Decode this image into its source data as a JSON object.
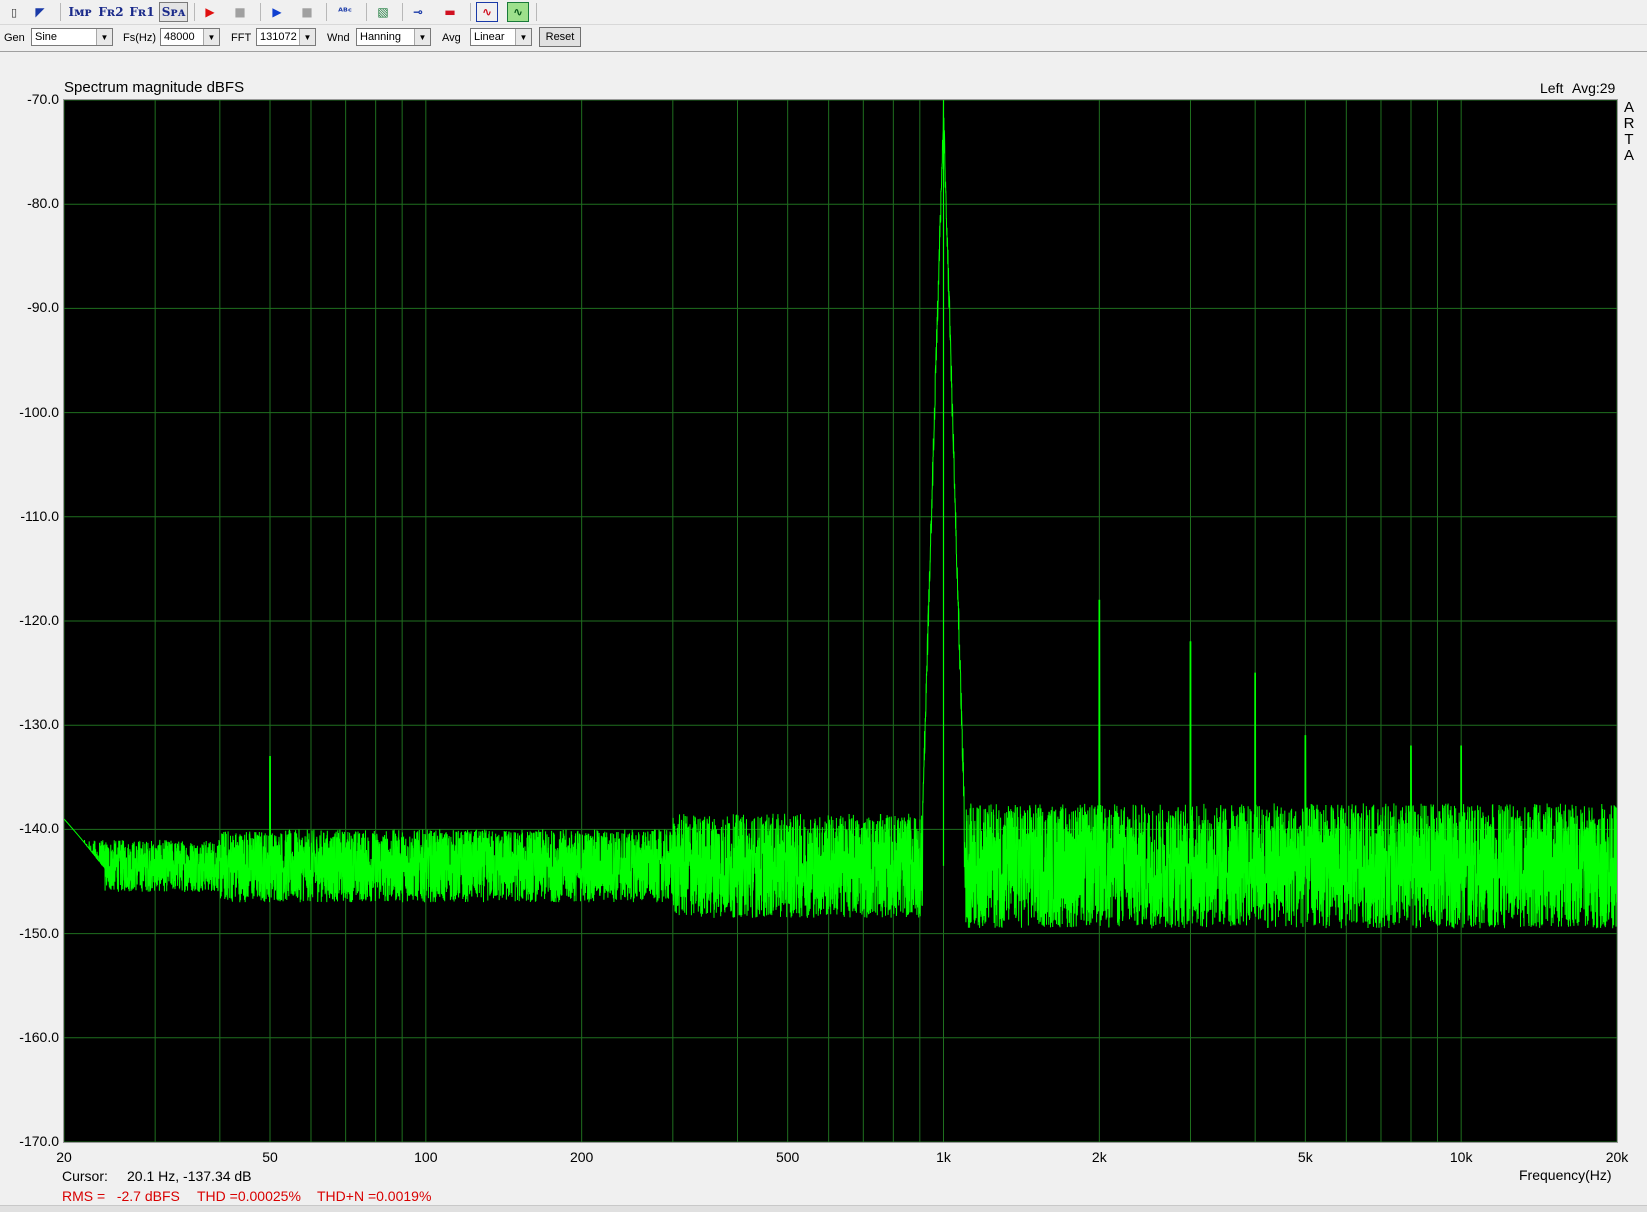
{
  "toolbar": {
    "buttons": [
      {
        "name": "new-icon",
        "glyph": "▯"
      },
      {
        "name": "open-icon",
        "glyph": "◤"
      },
      {
        "name": "imp-button",
        "glyph": "Iᴍᴘ"
      },
      {
        "name": "fr2-button",
        "glyph": "Fʀ2"
      },
      {
        "name": "fr1-button",
        "glyph": "Fʀ1"
      },
      {
        "name": "spa-button",
        "glyph": "Sᴘᴀ"
      },
      {
        "name": "record-icon",
        "glyph": "▶"
      },
      {
        "name": "stop-icon",
        "glyph": "■"
      },
      {
        "name": "play-icon",
        "glyph": "▶"
      },
      {
        "name": "stop2-icon",
        "glyph": "■"
      },
      {
        "name": "abc-icon",
        "glyph": "ᴬᴮᶜ"
      },
      {
        "name": "hatch-icon",
        "glyph": "▧"
      },
      {
        "name": "connector-icon",
        "glyph": "⊸"
      },
      {
        "name": "meter-icon",
        "glyph": "▬"
      },
      {
        "name": "wave-icon",
        "glyph": "∿"
      },
      {
        "name": "scope-icon",
        "glyph": "∿"
      }
    ]
  },
  "controls": {
    "gen_label": "Gen",
    "gen_value": "Sine",
    "fs_label": "Fs(Hz)",
    "fs_value": "48000",
    "fft_label": "FFT",
    "fft_value": "131072",
    "wnd_label": "Wnd",
    "wnd_value": "Hanning",
    "avg_label": "Avg",
    "avg_value": "Linear",
    "reset_label": "Reset"
  },
  "graph": {
    "title": "Spectrum magnitude dBFS",
    "channel": "Left",
    "avg": "Avg:29",
    "brand_letters": [
      "A",
      "R",
      "T",
      "A"
    ],
    "xlabel": "Frequency(Hz)",
    "cursor_label": "Cursor:",
    "cursor_value": "20.1 Hz, -137.34 dB",
    "rms": "RMS =   -2.7 dBFS",
    "thd": "THD =0.00025%",
    "thdn": "THD+N =0.0019%"
  },
  "chart_data": {
    "type": "line",
    "x_scale": "log",
    "xlim": [
      20,
      20000
    ],
    "ylim": [
      -170,
      -70
    ],
    "yticks": [
      -70,
      -80,
      -90,
      -100,
      -110,
      -120,
      -130,
      -140,
      -150,
      -160,
      -170
    ],
    "ytick_labels": [
      "-70.0",
      "-80.0",
      "-90.0",
      "-100.0",
      "-110.0",
      "-120.0",
      "-130.0",
      "-140.0",
      "-150.0",
      "-160.0",
      "-170.0"
    ],
    "xticks": [
      20,
      50,
      100,
      200,
      500,
      1000,
      2000,
      5000,
      10000,
      20000
    ],
    "xtick_labels": [
      "20",
      "50",
      "100",
      "200",
      "500",
      "1k",
      "2k",
      "5k",
      "10k",
      "20k"
    ],
    "grid": true,
    "background": "#000000",
    "grid_color": "#1f6f1f",
    "line_color": "#00ff00",
    "noise_floor_db": -143.5,
    "peaks": [
      {
        "freq": 1000,
        "db": -70
      },
      {
        "freq": 50,
        "db": -133
      },
      {
        "freq": 2000,
        "db": -118
      },
      {
        "freq": 3000,
        "db": -122
      },
      {
        "freq": 4000,
        "db": -125
      },
      {
        "freq": 5000,
        "db": -131
      },
      {
        "freq": 8000,
        "db": -132
      },
      {
        "freq": 10000,
        "db": -132
      }
    ]
  }
}
